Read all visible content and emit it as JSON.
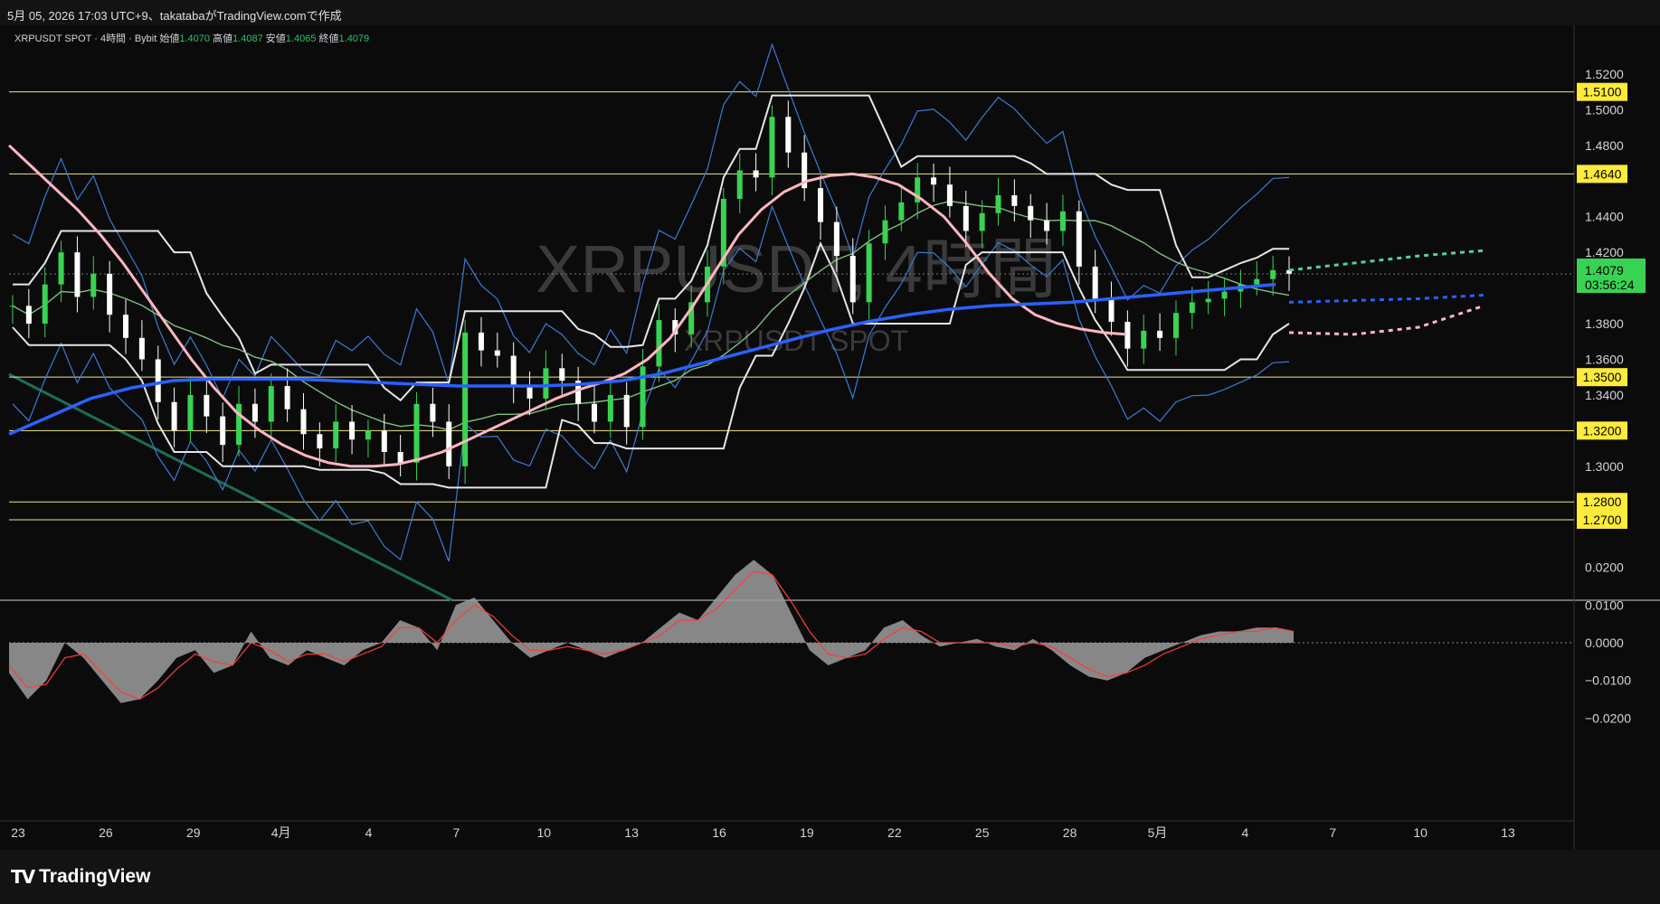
{
  "header": {
    "title": "5月 05, 2026 17:03 UTC+9、takatabaがTradingView.comで作成"
  },
  "legend": {
    "symbol": "XRPUSDT SPOT · 4時間 · Bybit",
    "open_label": "始値",
    "open": "1.4070",
    "high_label": "高値",
    "high": "1.4087",
    "low_label": "安値",
    "low": "1.4065",
    "close_label": "終値",
    "close": "1.4079"
  },
  "watermark": {
    "main": "XRPUSDT, 4時間",
    "sub": "XRPUSDT SPOT"
  },
  "footer": {
    "brand": "TradingView"
  },
  "colors": {
    "background": "#0b0b0b",
    "hline": "#f0e68c",
    "badge": "#ffeb3b",
    "current_badge": "#39d353",
    "candle_up": "#39d353",
    "candle_down": "#ffffff",
    "ma_fast": "#ffb6c1",
    "ma_slow": "#2962ff",
    "ma_mid": "#7fbf7f",
    "donchian": "#e6e6e6",
    "bollinger": "#3a7bd5",
    "trendline": "#1b6e55",
    "osc_area": "#9e9e9e",
    "osc_signal": "#ff3b3b"
  },
  "chart_data": [
    {
      "type": "line",
      "name_hidden": true,
      "y_axis_ticks": [
        "1.5200",
        "1.5000",
        "1.4800",
        "1.4400",
        "1.4200",
        "1.3800",
        "1.3600",
        "1.3400",
        "1.3000"
      ],
      "ylim": [
        1.262,
        1.532
      ],
      "x_axis_ticks": [
        "23",
        "26",
        "29",
        "4月",
        "4",
        "7",
        "10",
        "13",
        "16",
        "19",
        "22",
        "25",
        "28",
        "5月",
        "4",
        "7",
        "10",
        "13"
      ],
      "horizontal_levels": [
        "1.5100",
        "1.4640",
        "1.3500",
        "1.3200",
        "1.2800",
        "1.2700"
      ],
      "current_price": "1.4079",
      "countdown": "03:56:24",
      "price_path": [
        1.39,
        1.38,
        1.402,
        1.42,
        1.395,
        1.408,
        1.385,
        1.372,
        1.36,
        1.336,
        1.32,
        1.34,
        1.328,
        1.312,
        1.335,
        1.325,
        1.345,
        1.332,
        1.318,
        1.31,
        1.325,
        1.315,
        1.32,
        1.308,
        1.302,
        1.335,
        1.325,
        1.3,
        1.375,
        1.365,
        1.362,
        1.345,
        1.338,
        1.355,
        1.348,
        1.335,
        1.325,
        1.34,
        1.322,
        1.356,
        1.382,
        1.374,
        1.392,
        1.412,
        1.45,
        1.466,
        1.462,
        1.496,
        1.476,
        1.456,
        1.437,
        1.418,
        1.392,
        1.425,
        1.438,
        1.448,
        1.462,
        1.458,
        1.446,
        1.432,
        1.442,
        1.452,
        1.446,
        1.438,
        1.432,
        1.443,
        1.412,
        1.394,
        1.381,
        1.366,
        1.376,
        1.372,
        1.386,
        1.392,
        1.394,
        1.398,
        1.402,
        1.405,
        1.41,
        1.408
      ],
      "ma_fast": [
        1.48,
        1.468,
        1.456,
        1.444,
        1.43,
        1.414,
        1.396,
        1.378,
        1.36,
        1.344,
        1.33,
        1.32,
        1.312,
        1.306,
        1.302,
        1.3,
        1.3,
        1.301,
        1.304,
        1.308,
        1.314,
        1.32,
        1.326,
        1.332,
        1.338,
        1.343,
        1.347,
        1.352,
        1.36,
        1.372,
        1.39,
        1.41,
        1.43,
        1.444,
        1.454,
        1.46,
        1.463,
        1.464,
        1.462,
        1.458,
        1.45,
        1.44,
        1.425,
        1.408,
        1.394,
        1.385,
        1.38,
        1.377,
        1.375,
        1.374
      ],
      "ma_slow": [
        1.318,
        1.328,
        1.338,
        1.344,
        1.348,
        1.349,
        1.349,
        1.349,
        1.348,
        1.347,
        1.346,
        1.345,
        1.345,
        1.345,
        1.346,
        1.348,
        1.352,
        1.358,
        1.364,
        1.37,
        1.376,
        1.381,
        1.385,
        1.388,
        1.39,
        1.391,
        1.392,
        1.394,
        1.396,
        1.398,
        1.4,
        1.402
      ],
      "projections": [
        {
          "name_hidden": true,
          "y": [
            1.41,
            1.414,
            1.418,
            1.421
          ]
        },
        {
          "name_hidden": true,
          "y": [
            1.392,
            1.393,
            1.394,
            1.396
          ]
        },
        {
          "name_hidden": true,
          "y": [
            1.375,
            1.374,
            1.378,
            1.39
          ]
        }
      ]
    },
    {
      "type": "area",
      "y_axis_ticks": [
        "0.0200",
        "0.0100",
        "0.0000",
        "−0.0100",
        "−0.0200"
      ],
      "ylim": [
        -0.021,
        0.025
      ],
      "histogram": [
        -0.008,
        -0.015,
        -0.01,
        0.0,
        -0.004,
        -0.01,
        -0.016,
        -0.015,
        -0.01,
        -0.004,
        -0.002,
        -0.008,
        -0.006,
        0.003,
        -0.004,
        -0.006,
        -0.002,
        -0.004,
        -0.006,
        -0.002,
        0.0,
        0.006,
        0.004,
        -0.002,
        0.01,
        0.012,
        0.006,
        0.0,
        -0.004,
        -0.002,
        0.0,
        -0.002,
        -0.004,
        -0.002,
        0.0,
        0.004,
        0.008,
        0.006,
        0.012,
        0.018,
        0.022,
        0.018,
        0.008,
        -0.002,
        -0.006,
        -0.004,
        -0.002,
        0.004,
        0.006,
        0.002,
        -0.001,
        0.0,
        0.001,
        -0.001,
        -0.002,
        0.001,
        -0.002,
        -0.006,
        -0.009,
        -0.01,
        -0.008,
        -0.004,
        -0.002,
        0.0,
        0.002,
        0.003,
        0.003,
        0.004,
        0.004,
        0.003
      ],
      "signal": [
        -0.006,
        -0.012,
        -0.011,
        -0.004,
        -0.003,
        -0.008,
        -0.013,
        -0.015,
        -0.012,
        -0.007,
        -0.003,
        -0.005,
        -0.006,
        0.0,
        -0.002,
        -0.005,
        -0.003,
        -0.003,
        -0.005,
        -0.003,
        -0.001,
        0.004,
        0.004,
        0.0,
        0.006,
        0.01,
        0.007,
        0.002,
        -0.002,
        -0.002,
        -0.001,
        -0.002,
        -0.003,
        -0.002,
        0.0,
        0.002,
        0.006,
        0.006,
        0.009,
        0.014,
        0.019,
        0.018,
        0.011,
        0.003,
        -0.003,
        -0.004,
        -0.003,
        0.001,
        0.004,
        0.003,
        0.0,
        0.0,
        0.0,
        0.0,
        -0.001,
        0.0,
        -0.001,
        -0.004,
        -0.007,
        -0.009,
        -0.008,
        -0.006,
        -0.003,
        -0.001,
        0.001,
        0.002,
        0.003,
        0.003,
        0.004,
        0.003
      ]
    }
  ]
}
